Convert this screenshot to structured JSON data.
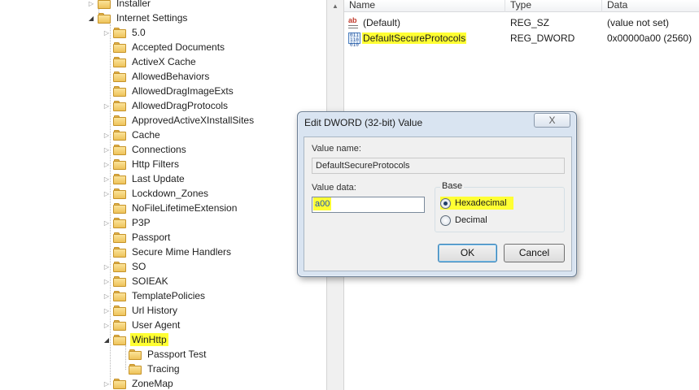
{
  "tree": {
    "items": [
      {
        "label": "Installer",
        "indent": 1,
        "expander": "collapsed"
      },
      {
        "label": "Internet Settings",
        "indent": 1,
        "expander": "expanded"
      },
      {
        "label": "5.0",
        "indent": 2,
        "expander": "collapsed"
      },
      {
        "label": "Accepted Documents",
        "indent": 2,
        "expander": "none"
      },
      {
        "label": "ActiveX Cache",
        "indent": 2,
        "expander": "none"
      },
      {
        "label": "AllowedBehaviors",
        "indent": 2,
        "expander": "none"
      },
      {
        "label": "AllowedDragImageExts",
        "indent": 2,
        "expander": "none"
      },
      {
        "label": "AllowedDragProtocols",
        "indent": 2,
        "expander": "collapsed"
      },
      {
        "label": "ApprovedActiveXInstallSites",
        "indent": 2,
        "expander": "none"
      },
      {
        "label": "Cache",
        "indent": 2,
        "expander": "collapsed"
      },
      {
        "label": "Connections",
        "indent": 2,
        "expander": "collapsed"
      },
      {
        "label": "Http Filters",
        "indent": 2,
        "expander": "collapsed"
      },
      {
        "label": "Last Update",
        "indent": 2,
        "expander": "collapsed"
      },
      {
        "label": "Lockdown_Zones",
        "indent": 2,
        "expander": "collapsed"
      },
      {
        "label": "NoFileLifetimeExtension",
        "indent": 2,
        "expander": "none"
      },
      {
        "label": "P3P",
        "indent": 2,
        "expander": "collapsed"
      },
      {
        "label": "Passport",
        "indent": 2,
        "expander": "none"
      },
      {
        "label": "Secure Mime Handlers",
        "indent": 2,
        "expander": "none"
      },
      {
        "label": "SO",
        "indent": 2,
        "expander": "collapsed"
      },
      {
        "label": "SOIEAK",
        "indent": 2,
        "expander": "collapsed"
      },
      {
        "label": "TemplatePolicies",
        "indent": 2,
        "expander": "collapsed"
      },
      {
        "label": "Url History",
        "indent": 2,
        "expander": "collapsed"
      },
      {
        "label": "User Agent",
        "indent": 2,
        "expander": "collapsed"
      },
      {
        "label": "WinHttp",
        "indent": 2,
        "expander": "expanded",
        "highlighted": true
      },
      {
        "label": "Passport Test",
        "indent": 3,
        "expander": "none"
      },
      {
        "label": "Tracing",
        "indent": 3,
        "expander": "none"
      },
      {
        "label": "ZoneMap",
        "indent": 2,
        "expander": "collapsed"
      }
    ]
  },
  "list": {
    "columns": {
      "name": "Name",
      "type": "Type",
      "data": "Data"
    },
    "rows": [
      {
        "name": "(Default)",
        "type": "REG_SZ",
        "data": "(value not set)",
        "icon": "string-value-icon"
      },
      {
        "name": "DefaultSecureProtocols",
        "type": "REG_DWORD",
        "data": "0x00000a00 (2560)",
        "icon": "binary-value-icon",
        "highlighted": true
      }
    ]
  },
  "dialog": {
    "title": "Edit DWORD (32-bit) Value",
    "close_glyph": "X",
    "value_name_label": "Value name:",
    "value_name": "DefaultSecureProtocols",
    "value_data_label": "Value data:",
    "value_data": "a00",
    "base_label": "Base",
    "base_options": [
      {
        "label": "Hexadecimal",
        "selected": true
      },
      {
        "label": "Decimal",
        "selected": false
      }
    ],
    "ok_label": "OK",
    "cancel_label": "Cancel"
  },
  "colors": {
    "highlight": "#ffff33",
    "folder": "#eec35a"
  }
}
